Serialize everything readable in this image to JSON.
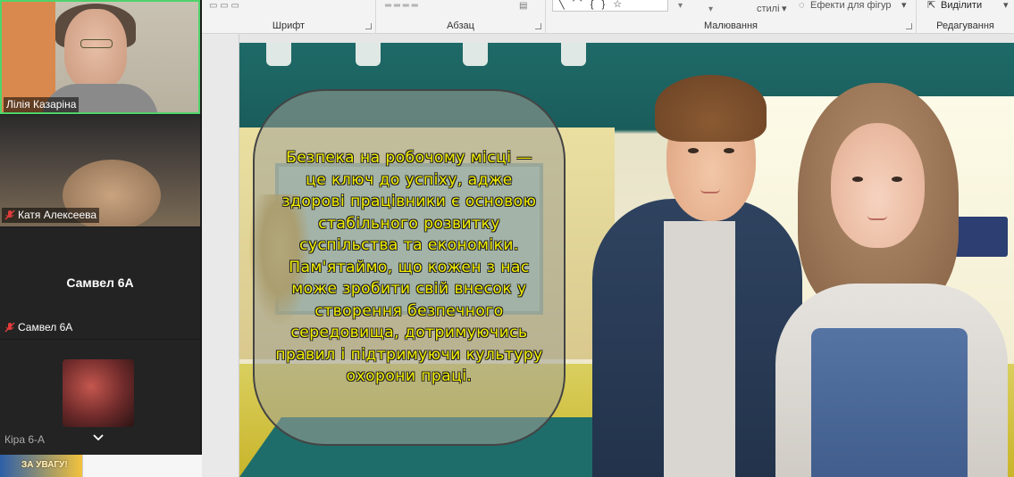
{
  "ribbon": {
    "groups": {
      "font": "Шрифт",
      "paragraph": "Абзац",
      "drawing": "Малювання",
      "editing": "Редагування"
    },
    "styles_label": "стилі",
    "shape_effects_label": "Ефекти для фігур",
    "select_label": "Виділити",
    "shapes_glyphs": "╲ ⌒ { } ☆"
  },
  "slide": {
    "quote": "Безпека на робочому місці — це ключ до успіху, адже здорові працівники є основою стабільного розвитку суспільства та економіки. Пам'ятаймо, що кожен з нас може зробити свій внесок у створення безпечного середовища, дотримуючись правил і підтримуючи культуру охорони праці."
  },
  "call": {
    "participants": [
      {
        "name": "Лілія Казаріна",
        "muted": false,
        "active_speaker": true
      },
      {
        "name": "Катя Алексеева",
        "muted": true
      },
      {
        "name": "Самвел 6А",
        "muted": true,
        "camera_off": true
      },
      {
        "name": "Кіра 6-А",
        "muted": false
      }
    ]
  },
  "thumbnail_banner": "ЗА УВАГУ!"
}
